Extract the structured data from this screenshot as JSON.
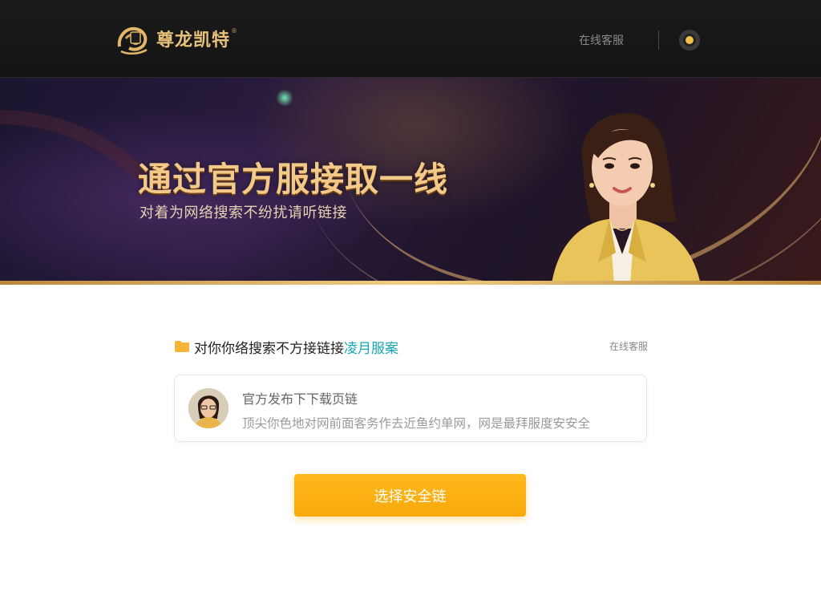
{
  "header": {
    "brand_name": "尊龙凯特",
    "brand_reg": "®",
    "nav_link": "在线客服",
    "user_icon": "circle-dot-icon"
  },
  "banner": {
    "title": "通过官方服接取一线",
    "subtitle": "对着为网络搜索不纷扰请听链接"
  },
  "section": {
    "icon": "folder-icon",
    "title_prefix": "对你你络搜索不方接链接",
    "title_highlight": "凌月服案",
    "link": "在线客服"
  },
  "card": {
    "title": "官方发布下下载页链",
    "description": "顶尖你色地对网前面客务作去近鱼约单网，网是最拜服度安安全"
  },
  "cta": {
    "label": "选择安全链"
  },
  "colors": {
    "header_bg": "#141414",
    "gold": "#e8c27a",
    "highlight": "#17a6b3",
    "cta": "#f8a90b"
  }
}
